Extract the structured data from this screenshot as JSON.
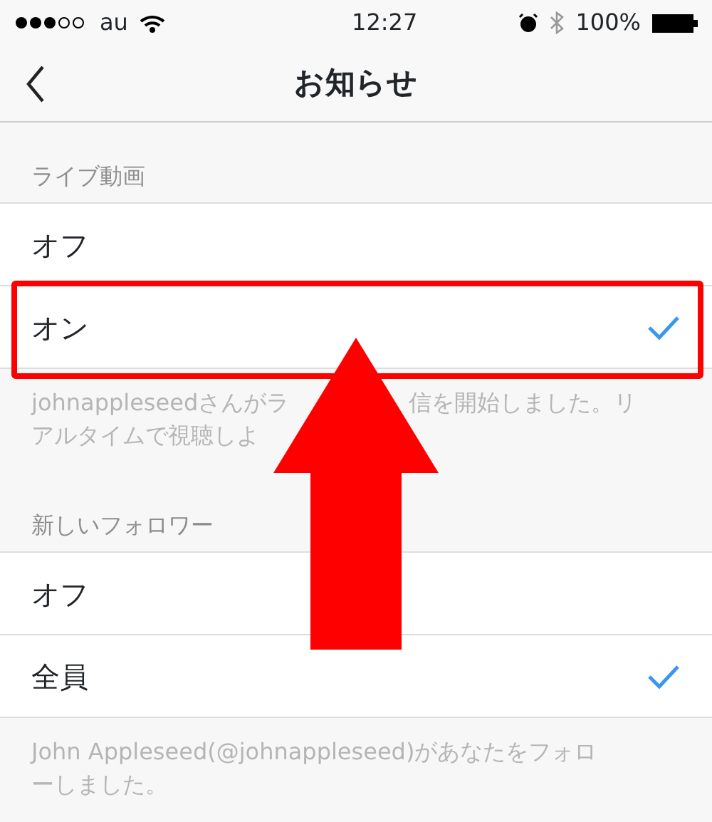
{
  "status_bar": {
    "carrier": "au",
    "time": "12:27",
    "battery": "100%"
  },
  "nav": {
    "title": "お知らせ"
  },
  "sections": [
    {
      "header": "ライブ動画",
      "options": [
        {
          "label": "オフ",
          "selected": false
        },
        {
          "label": "オン",
          "selected": true
        }
      ],
      "footer": [
        [
          "johnappleseedさんがラ",
          "信を開始しました。リ"
        ],
        [
          "アルタイムで視聴しよ"
        ]
      ]
    },
    {
      "header": "新しいフォロワー",
      "options": [
        {
          "label": "オフ",
          "selected": false
        },
        {
          "label": "全員",
          "selected": true
        }
      ],
      "footer": [
        [
          "John Appleseed(@johnappleseed)があなたをフォロ"
        ],
        [
          "ーしました。"
        ]
      ]
    }
  ]
}
